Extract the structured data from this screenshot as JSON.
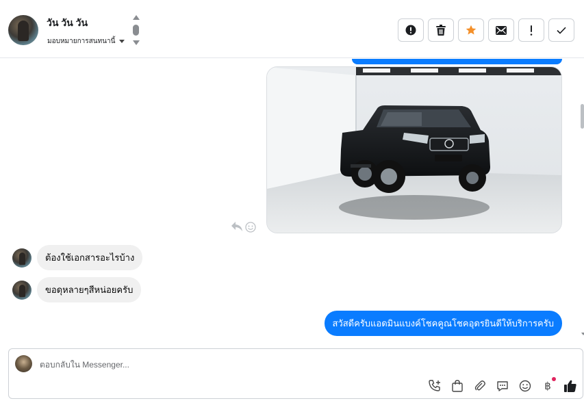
{
  "header": {
    "contact_name": "วัน วัน วัน",
    "assign_label": "มอบหมายการสนทนานี้",
    "tools": [
      {
        "name": "report-spam-button",
        "icon": "exclamation-circle-icon"
      },
      {
        "name": "delete-button",
        "icon": "trash-icon"
      },
      {
        "name": "star-button",
        "icon": "star-icon"
      },
      {
        "name": "mark-unread-button",
        "icon": "envelope-icon"
      },
      {
        "name": "follow-up-button",
        "icon": "exclamation-icon"
      },
      {
        "name": "mark-done-button",
        "icon": "check-icon"
      }
    ]
  },
  "messages": {
    "incoming": [
      {
        "text": "ต้องใช้เอกสารอะไรบ้าง"
      },
      {
        "text": "ขอดุหลายๆสีหน่อยครับ"
      }
    ],
    "outgoing": {
      "text": "สวัสดีครับแอดมินแบงค์โชคคูณโชคอุดรยินดีให้บริการครับ"
    }
  },
  "composer": {
    "placeholder": "ตอบกลับใน Messenger..."
  },
  "colors": {
    "accent": "#0a7cff",
    "star": "#f4902a",
    "incoming_bubble": "#f0f0f0"
  }
}
